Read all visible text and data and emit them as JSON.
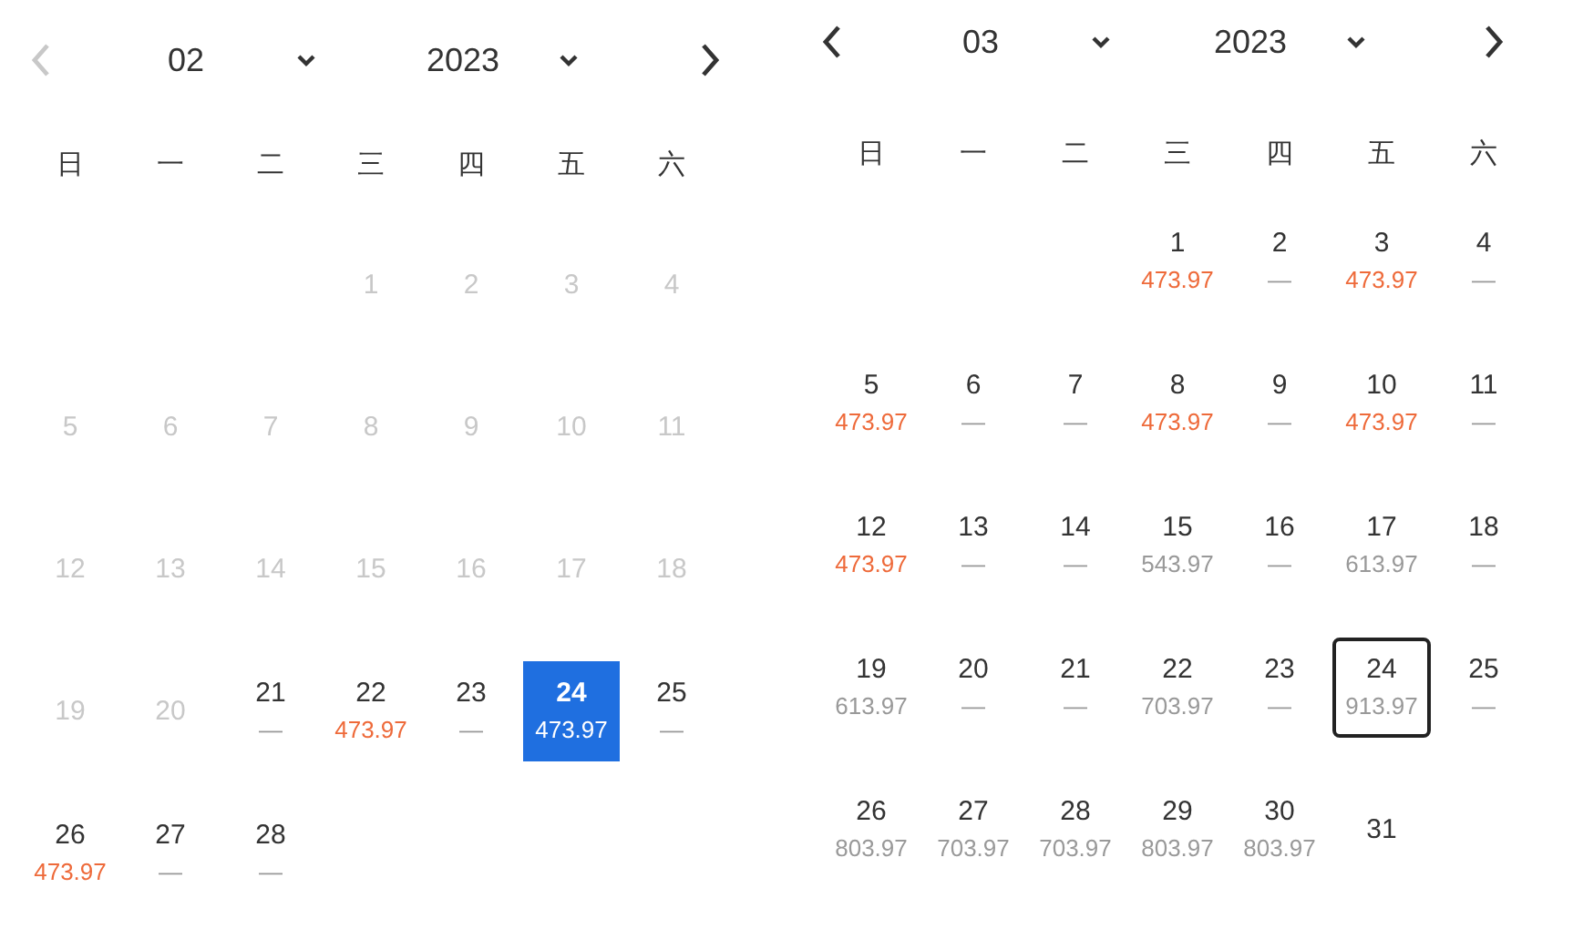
{
  "months": [
    {
      "month": "02",
      "year": "2023",
      "prev_disabled": true,
      "next_disabled": false,
      "weekdays": [
        "日",
        "一",
        "二",
        "三",
        "四",
        "五",
        "六"
      ],
      "weeks": [
        [
          {
            "kind": "blank"
          },
          {
            "kind": "blank"
          },
          {
            "kind": "blank"
          },
          {
            "kind": "day",
            "day": "1",
            "available": false,
            "selected": false,
            "today": false
          },
          {
            "kind": "day",
            "day": "2",
            "available": false,
            "selected": false,
            "today": false
          },
          {
            "kind": "day",
            "day": "3",
            "available": false,
            "selected": false,
            "today": false
          },
          {
            "kind": "day",
            "day": "4",
            "available": false,
            "selected": false,
            "today": false
          }
        ],
        [
          {
            "kind": "day",
            "day": "5",
            "available": false,
            "selected": false,
            "today": false
          },
          {
            "kind": "day",
            "day": "6",
            "available": false,
            "selected": false,
            "today": false
          },
          {
            "kind": "day",
            "day": "7",
            "available": false,
            "selected": false,
            "today": false
          },
          {
            "kind": "day",
            "day": "8",
            "available": false,
            "selected": false,
            "today": false
          },
          {
            "kind": "day",
            "day": "9",
            "available": false,
            "selected": false,
            "today": false
          },
          {
            "kind": "day",
            "day": "10",
            "available": false,
            "selected": false,
            "today": false
          },
          {
            "kind": "day",
            "day": "11",
            "available": false,
            "selected": false,
            "today": false
          }
        ],
        [
          {
            "kind": "day",
            "day": "12",
            "available": false,
            "selected": false,
            "today": false
          },
          {
            "kind": "day",
            "day": "13",
            "available": false,
            "selected": false,
            "today": false
          },
          {
            "kind": "day",
            "day": "14",
            "available": false,
            "selected": false,
            "today": false
          },
          {
            "kind": "day",
            "day": "15",
            "available": false,
            "selected": false,
            "today": false
          },
          {
            "kind": "day",
            "day": "16",
            "available": false,
            "selected": false,
            "today": false
          },
          {
            "kind": "day",
            "day": "17",
            "available": false,
            "selected": false,
            "today": false
          },
          {
            "kind": "day",
            "day": "18",
            "available": false,
            "selected": false,
            "today": false
          }
        ],
        [
          {
            "kind": "day",
            "day": "19",
            "available": false,
            "selected": false,
            "today": false
          },
          {
            "kind": "day",
            "day": "20",
            "available": false,
            "selected": false,
            "today": false
          },
          {
            "kind": "day",
            "day": "21",
            "price": "—",
            "available": true,
            "selected": false,
            "today": false
          },
          {
            "kind": "day",
            "day": "22",
            "price": "473.97",
            "available": true,
            "deal": true,
            "selected": false,
            "today": false
          },
          {
            "kind": "day",
            "day": "23",
            "price": "—",
            "available": true,
            "selected": false,
            "today": false
          },
          {
            "kind": "day",
            "day": "24",
            "price": "473.97",
            "available": true,
            "deal": true,
            "selected": true,
            "today": false
          },
          {
            "kind": "day",
            "day": "25",
            "price": "—",
            "available": true,
            "selected": false,
            "today": false
          }
        ],
        [
          {
            "kind": "day",
            "day": "26",
            "price": "473.97",
            "available": true,
            "deal": true,
            "selected": false,
            "today": false
          },
          {
            "kind": "day",
            "day": "27",
            "price": "—",
            "available": true,
            "selected": false,
            "today": false
          },
          {
            "kind": "day",
            "day": "28",
            "price": "—",
            "available": true,
            "selected": false,
            "today": false
          }
        ]
      ]
    },
    {
      "month": "03",
      "year": "2023",
      "prev_disabled": false,
      "next_disabled": false,
      "weekdays": [
        "日",
        "一",
        "二",
        "三",
        "四",
        "五",
        "六"
      ],
      "weeks": [
        [
          {
            "kind": "blank"
          },
          {
            "kind": "blank"
          },
          {
            "kind": "blank"
          },
          {
            "kind": "day",
            "day": "1",
            "price": "473.97",
            "available": true,
            "deal": true,
            "selected": false,
            "today": false
          },
          {
            "kind": "day",
            "day": "2",
            "price": "—",
            "available": true,
            "selected": false,
            "today": false
          },
          {
            "kind": "day",
            "day": "3",
            "price": "473.97",
            "available": true,
            "deal": true,
            "selected": false,
            "today": false
          },
          {
            "kind": "day",
            "day": "4",
            "price": "—",
            "available": true,
            "selected": false,
            "today": false
          }
        ],
        [
          {
            "kind": "day",
            "day": "5",
            "price": "473.97",
            "available": true,
            "deal": true,
            "selected": false,
            "today": false
          },
          {
            "kind": "day",
            "day": "6",
            "price": "—",
            "available": true,
            "selected": false,
            "today": false
          },
          {
            "kind": "day",
            "day": "7",
            "price": "—",
            "available": true,
            "selected": false,
            "today": false
          },
          {
            "kind": "day",
            "day": "8",
            "price": "473.97",
            "available": true,
            "deal": true,
            "selected": false,
            "today": false
          },
          {
            "kind": "day",
            "day": "9",
            "price": "—",
            "available": true,
            "selected": false,
            "today": false
          },
          {
            "kind": "day",
            "day": "10",
            "price": "473.97",
            "available": true,
            "deal": true,
            "selected": false,
            "today": false
          },
          {
            "kind": "day",
            "day": "11",
            "price": "—",
            "available": true,
            "selected": false,
            "today": false
          }
        ],
        [
          {
            "kind": "day",
            "day": "12",
            "price": "473.97",
            "available": true,
            "deal": true,
            "selected": false,
            "today": false
          },
          {
            "kind": "day",
            "day": "13",
            "price": "—",
            "available": true,
            "selected": false,
            "today": false
          },
          {
            "kind": "day",
            "day": "14",
            "price": "—",
            "available": true,
            "selected": false,
            "today": false
          },
          {
            "kind": "day",
            "day": "15",
            "price": "543.97",
            "available": true,
            "deal": false,
            "selected": false,
            "today": false
          },
          {
            "kind": "day",
            "day": "16",
            "price": "—",
            "available": true,
            "selected": false,
            "today": false
          },
          {
            "kind": "day",
            "day": "17",
            "price": "613.97",
            "available": true,
            "deal": false,
            "selected": false,
            "today": false
          },
          {
            "kind": "day",
            "day": "18",
            "price": "—",
            "available": true,
            "selected": false,
            "today": false
          }
        ],
        [
          {
            "kind": "day",
            "day": "19",
            "price": "613.97",
            "available": true,
            "deal": false,
            "selected": false,
            "today": false
          },
          {
            "kind": "day",
            "day": "20",
            "price": "—",
            "available": true,
            "selected": false,
            "today": false
          },
          {
            "kind": "day",
            "day": "21",
            "price": "—",
            "available": true,
            "selected": false,
            "today": false
          },
          {
            "kind": "day",
            "day": "22",
            "price": "703.97",
            "available": true,
            "deal": false,
            "selected": false,
            "today": false
          },
          {
            "kind": "day",
            "day": "23",
            "price": "—",
            "available": true,
            "selected": false,
            "today": false
          },
          {
            "kind": "day",
            "day": "24",
            "price": "913.97",
            "available": true,
            "deal": false,
            "selected": false,
            "today": true
          },
          {
            "kind": "day",
            "day": "25",
            "price": "—",
            "available": true,
            "selected": false,
            "today": false
          }
        ],
        [
          {
            "kind": "day",
            "day": "26",
            "price": "803.97",
            "available": true,
            "deal": false,
            "selected": false,
            "today": false
          },
          {
            "kind": "day",
            "day": "27",
            "price": "703.97",
            "available": true,
            "deal": false,
            "selected": false,
            "today": false
          },
          {
            "kind": "day",
            "day": "28",
            "price": "703.97",
            "available": true,
            "deal": false,
            "selected": false,
            "today": false
          },
          {
            "kind": "day",
            "day": "29",
            "price": "803.97",
            "available": true,
            "deal": false,
            "selected": false,
            "today": false
          },
          {
            "kind": "day",
            "day": "30",
            "price": "803.97",
            "available": true,
            "deal": false,
            "selected": false,
            "today": false
          },
          {
            "kind": "day",
            "day": "31",
            "available": true,
            "selected": false,
            "today": false
          }
        ]
      ]
    }
  ]
}
